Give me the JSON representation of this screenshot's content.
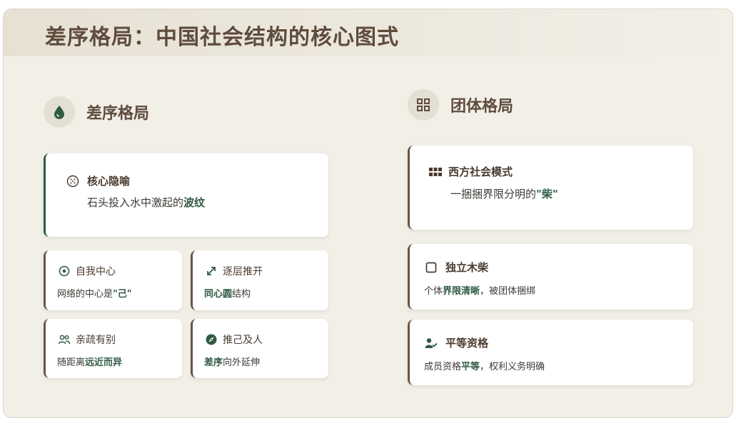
{
  "page_title": "差序格局：中国社会结构的核心图式",
  "left": {
    "heading": "差序格局",
    "heading_icon": "water-drop-icon",
    "main_card": {
      "title": "核心隐喻",
      "icon": "circle-grid-icon",
      "desc_prefix": "石头投入水中激起的",
      "desc_emphasis": "波纹"
    },
    "cards": [
      {
        "title": "自我中心",
        "icon": "target-icon",
        "desc_prefix": "网络的中心是",
        "desc_emphasis": "\"己\"",
        "desc_suffix": ""
      },
      {
        "title": "逐层推开",
        "icon": "expand-arrow-icon",
        "desc_prefix": "",
        "desc_emphasis": "同心圆",
        "desc_suffix": "结构"
      },
      {
        "title": "亲疏有别",
        "icon": "people-icon",
        "desc_prefix": "随距离",
        "desc_emphasis": "远近而异",
        "desc_suffix": ""
      },
      {
        "title": "推己及人",
        "icon": "compass-icon",
        "desc_prefix": "",
        "desc_emphasis": "差序",
        "desc_suffix": "向外延伸"
      }
    ]
  },
  "right": {
    "heading": "团体格局",
    "heading_icon": "grid-icon",
    "main_card": {
      "title": "西方社会模式",
      "icon": "blocks-icon",
      "desc_prefix": "一捆捆界限分明的",
      "desc_emphasis": "\"柴\""
    },
    "cards": [
      {
        "title": "独立木柴",
        "icon": "square-icon",
        "desc_prefix": "个体",
        "desc_emphasis": "界限清晰",
        "desc_suffix": "，被团体捆绑"
      },
      {
        "title": "平等资格",
        "icon": "user-check-icon",
        "desc_prefix": "成员资格",
        "desc_emphasis": "平等",
        "desc_suffix": "，权利义务明确"
      }
    ]
  },
  "colors": {
    "accent_green": "#2f5a44",
    "accent_brown": "#6b5444",
    "background": "#f2efe7"
  }
}
